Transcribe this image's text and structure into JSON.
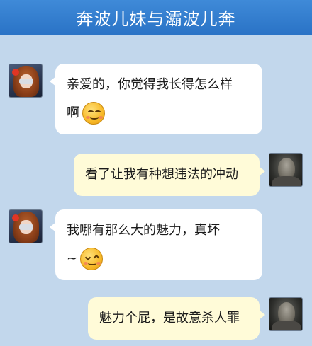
{
  "header": {
    "title": "奔波儿妹与灞波儿奔"
  },
  "messages": [
    {
      "side": "left",
      "sender_avatar": "girl-avatar",
      "lines": [
        "亲爱的，你觉得我长得怎么样",
        "啊"
      ],
      "emoji": "smile-emoji"
    },
    {
      "side": "right",
      "sender_avatar": "boy-avatar",
      "lines": [
        "看了让我有种想违法的冲动"
      ]
    },
    {
      "side": "left",
      "sender_avatar": "girl-avatar",
      "lines": [
        "我哪有那么大的魅力，真坏",
        "~"
      ],
      "emoji": "squint-smile-emoji"
    },
    {
      "side": "right",
      "sender_avatar": "boy-avatar",
      "lines": [
        "魅力个屁，是故意杀人罪"
      ]
    }
  ],
  "colors": {
    "background": "#c2d7ec",
    "titlebar": "#2f7bd0",
    "bubble_left": "#ffffff",
    "bubble_right": "#fffbd8"
  }
}
